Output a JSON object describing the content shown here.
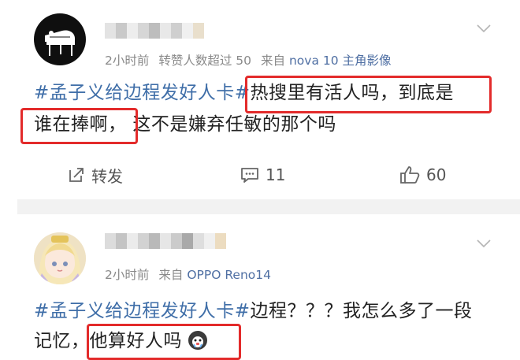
{
  "post1": {
    "avatar_icon": "piano-avatar-icon",
    "time": "2小时前",
    "likes_note": "转赞人数超过 50",
    "device_prefix": "来自",
    "device": "nova 10 主角影像",
    "topic": "#孟子义给边程发好人卡#",
    "line1_highlight": "热搜里有活人吗，到底是",
    "line2_highlight": "谁在捧啊，",
    "line2_rest": "这不是嫌弃任敏的那个吗",
    "repost_label": "转发",
    "comment_count": "11",
    "like_count": "60"
  },
  "post2": {
    "avatar_icon": "anime-girl-avatar-icon",
    "time": "2小时前",
    "device_prefix": "来自",
    "device": "OPPO Reno14",
    "topic": "#孟子义给边程发好人卡#",
    "line1_rest": "边程？？？我怎么多了一段",
    "line2_prefix": "记忆，",
    "line2_highlight": "他算好人吗",
    "emoji_icon": "crying-face-emoji-icon"
  },
  "colors": {
    "topic_blue": "#3f6ea8",
    "highlight_red": "#e32b2b",
    "meta_gray": "#8a8a8a"
  }
}
